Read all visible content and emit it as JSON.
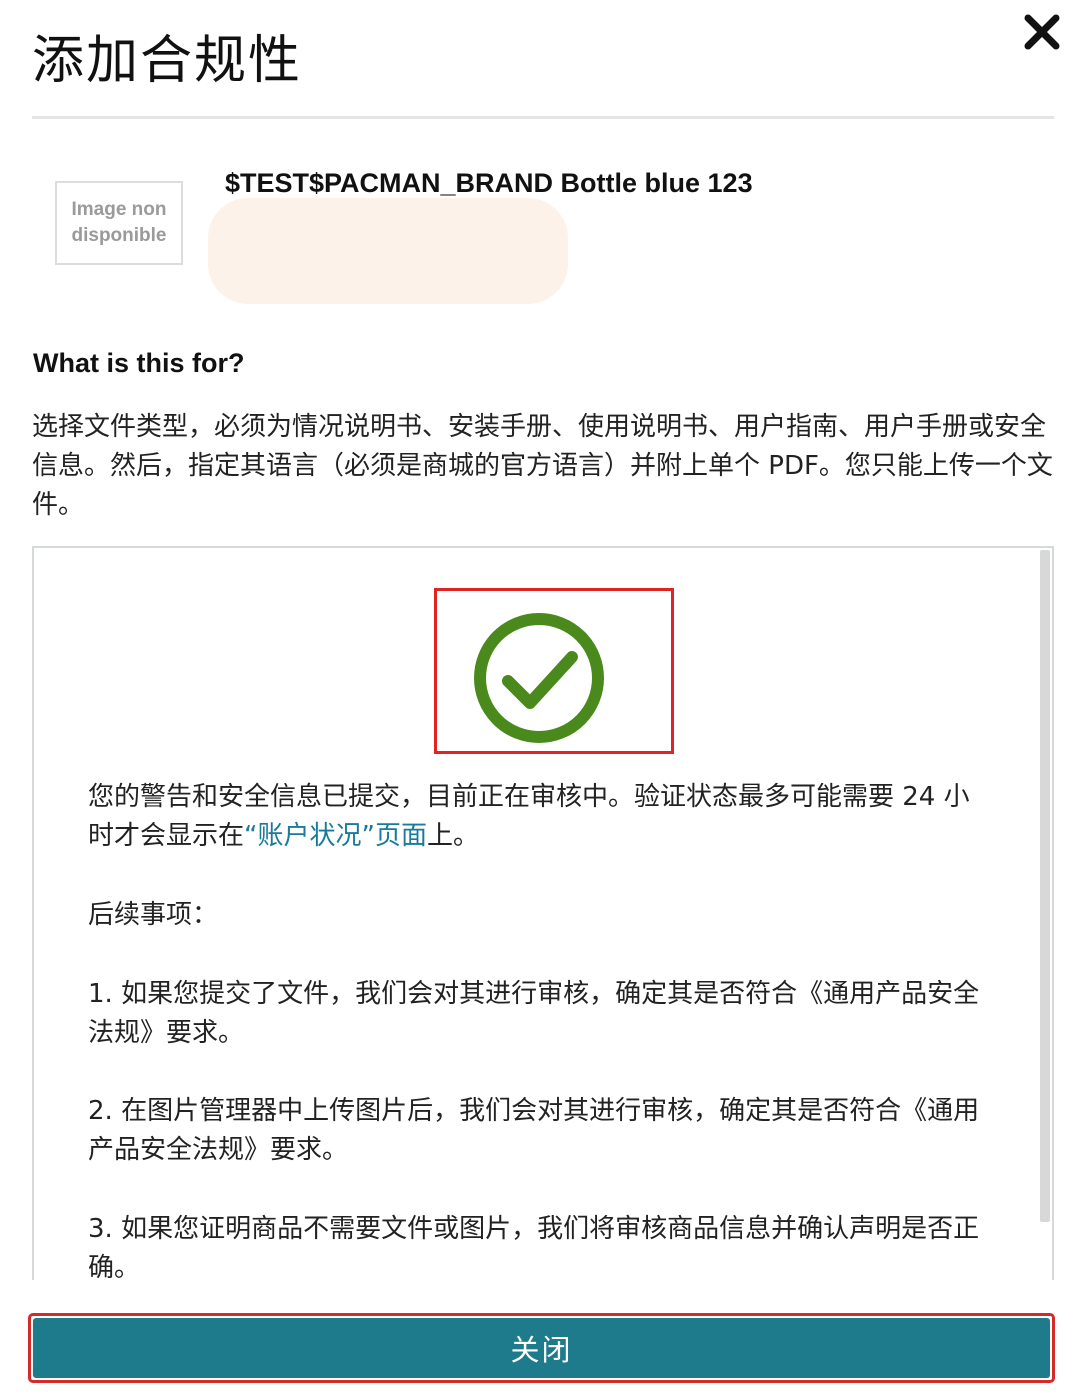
{
  "modal": {
    "title": "添加合规性",
    "close_icon": "close-x-icon"
  },
  "product": {
    "image_placeholder": "Image non disponible",
    "name": "$TEST$PACMAN_BRAND Bottle blue 123"
  },
  "info": {
    "heading": "What is this for?",
    "description": "选择文件类型，必须为情况说明书、安装手册、使用说明书、用户指南、用户手册或安全信息。然后，指定其语言（必须是商城的官方语言）并附上单个 PDF。您只能上传一个文件。"
  },
  "status": {
    "icon": "check-circle-icon",
    "icon_color": "#4a8a1c",
    "message_before_link": "您的警告和安全信息已提交，目前正在审核中。验证状态最多可能需要 24 小时才会显示在",
    "link_text": "“账户状况”页面",
    "message_after_link": "上。",
    "next_steps_heading": "后续事项：",
    "steps": [
      "1. 如果您提交了文件，我们会对其进行审核，确定其是否符合《通用产品安全法规》要求。",
      "2. 在图片管理器中上传图片后，我们会对其进行审核，确定其是否符合《通用产品安全法规》要求。",
      "3. 如果您证明商品不需要文件或图片，我们将审核商品信息并确认声明是否正确。"
    ]
  },
  "footer": {
    "close_label": "关闭",
    "button_color": "#1e7b8c"
  }
}
